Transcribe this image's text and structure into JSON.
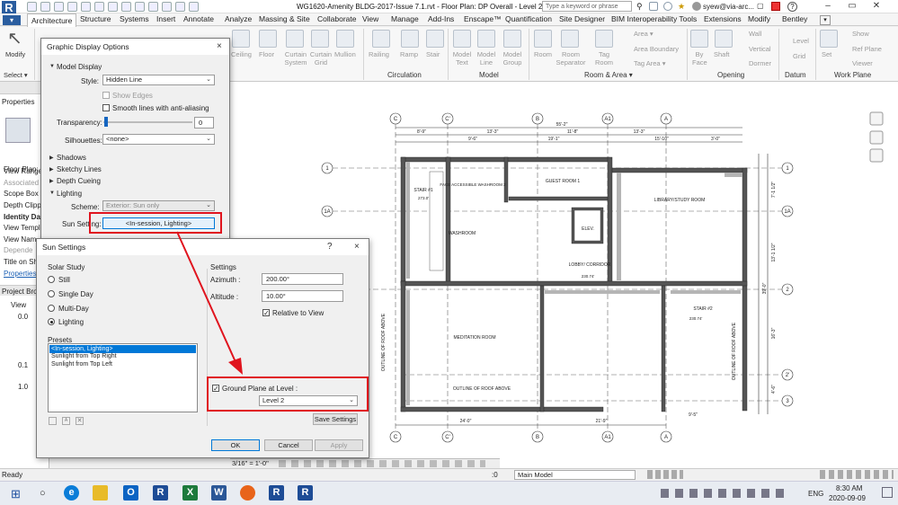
{
  "titlebar": {
    "app_logo": "R",
    "document_title": "WG1620-Amenity BLDG-2017-Issue 7.1.rvt - Floor Plan: DP Overall - Level 2",
    "search_placeholder": "Type a keyword or phrase",
    "user": "syew@via-arc...",
    "help": "?"
  },
  "ribbon_tabs": [
    "Architecture",
    "Structure",
    "Systems",
    "Insert",
    "Annotate",
    "Analyze",
    "Massing & Site",
    "Collaborate",
    "View",
    "Manage",
    "Add-Ins",
    "Enscape™",
    "Quantification",
    "Site Designer",
    "BIM Interoperability Tools",
    "Extensions",
    "Modify",
    "Bentley"
  ],
  "ribbon": {
    "modify": "Modify",
    "select": "Select ▾",
    "build_items": [
      "Ceiling",
      "Floor",
      "Curtain System",
      "Curtain Grid",
      "Mullion"
    ],
    "circulation_items": [
      "Railing",
      "Ramp",
      "Stair"
    ],
    "circulation_title": "Circulation",
    "model_items": [
      "Model Text",
      "Model Line",
      "Model Group"
    ],
    "model_title": "Model",
    "room_items": [
      "Room",
      "Room Separator",
      "Tag Room"
    ],
    "area_items": [
      "Area ▾",
      "Area Boundary",
      "Tag Area ▾"
    ],
    "room_title": "Room & Area ▾",
    "opening_items": [
      "By Face",
      "Shaft",
      "Wall",
      "Vertical",
      "Dormer"
    ],
    "opening_title": "Opening",
    "datum_items": [
      "Level",
      "Grid"
    ],
    "datum_title": "Datum",
    "workplane_items": [
      "Set",
      "Show",
      "Ref Plane",
      "Viewer"
    ],
    "workplane_title": "Work Plane"
  },
  "left_panel": {
    "properties_header": "Properties",
    "rows": [
      "Floor Plan: D",
      "View Range",
      "Associated L",
      "Scope Box",
      "Depth Clipp",
      "Identity Data",
      "View Templa",
      "View Nam",
      "Depende",
      "Title on Sh"
    ],
    "properties_help": "Properties h",
    "project_browser": "Project Brow",
    "tree": [
      "View",
      "0.0",
      "0.1",
      "1.0"
    ]
  },
  "graphic_display": {
    "title": "Graphic Display Options",
    "close": "×",
    "model_display": "Model Display",
    "style_label": "Style:",
    "style_value": "Hidden Line",
    "show_edges": "Show Edges",
    "smooth_lines": "Smooth lines with anti-aliasing",
    "transparency_label": "Transparency:",
    "transparency_value": "0",
    "silhouettes_label": "Silhouettes:",
    "silhouettes_value": "<none>",
    "shadows": "Shadows",
    "sketchy_lines": "Sketchy Lines",
    "depth_cueing": "Depth Cueing",
    "lighting": "Lighting",
    "scheme_label": "Scheme:",
    "scheme_value": "Exterior: Sun only",
    "sun_setting_label": "Sun Setting:",
    "sun_setting_value": "<In-session, Lighting>"
  },
  "sun_settings": {
    "title": "Sun Settings",
    "help": "?",
    "close": "×",
    "solar_study": "Solar Study",
    "options": [
      "Still",
      "Single Day",
      "Multi-Day",
      "Lighting"
    ],
    "selected_option": "Lighting",
    "presets_label": "Presets",
    "presets": [
      "<In-session, Lighting>",
      "Sunlight from Top Right",
      "Sunlight from Top Left"
    ],
    "settings_label": "Settings",
    "azimuth_label": "Azimuth :",
    "azimuth_value": "200.00°",
    "altitude_label": "Altitude :",
    "altitude_value": "10.00°",
    "relative_to_view": "Relative to View",
    "ground_plane_label": "Ground Plane at Level :",
    "ground_plane_value": "Level 2",
    "save_settings": "Save Settings",
    "ok": "OK",
    "cancel": "Cancel",
    "apply": "Apply"
  },
  "drawing": {
    "grid_top": [
      "C",
      "C'",
      "B",
      "A1",
      "A"
    ],
    "grid_bottom": [
      "C",
      "C'",
      "B",
      "A1",
      "A"
    ],
    "grid_left": [
      "1",
      "1A",
      "2"
    ],
    "grid_right": [
      "1",
      "1A",
      "2",
      "2'",
      "3"
    ],
    "dims_top": [
      "55'-2\"",
      "8'-9\"",
      "13'-3\"",
      "11'-8\"",
      "13'-3\"",
      "9'-6\"",
      "19'-1\"",
      "15'-10\"",
      "3'-0\""
    ],
    "dims_bottom": [
      "24'-0\"",
      "21'-9\"",
      "9'-5\""
    ],
    "dims_right": [
      "7'-1 1/2\"",
      "13'-1 1/2\"",
      "39'-0\"",
      "16'-3\"",
      "4'-6\""
    ],
    "rooms": [
      "GUEST ROOM 1",
      "LIBRARY/STUDY ROOM",
      "STAIR #1",
      "FACE ACCESSIBLE WASHROOM 2",
      "WASHROOM",
      "ELEV.",
      "LOBBY/ CORRIDOR",
      "MEDITATION ROOM",
      "STAIR #2"
    ],
    "tags": [
      "273.0'",
      "230.74'",
      "230.74'"
    ],
    "notes": [
      "OUTLINE OF ROOF ABOVE",
      "OUTLINE OF ROOF ABOVE",
      "OUTLINE OF ROOF ABOVE"
    ]
  },
  "view_control": {
    "scale": "3/16\" = 1'-0\""
  },
  "status": {
    "ready": "Ready",
    "model": "Main Model",
    "zero": ":0"
  },
  "taskbar": {
    "time": "8:30 AM",
    "date": "2020-09-09",
    "lang": "ENG"
  },
  "colors": {
    "annotation_red": "#e0141e",
    "selection_blue": "#0078d7"
  }
}
